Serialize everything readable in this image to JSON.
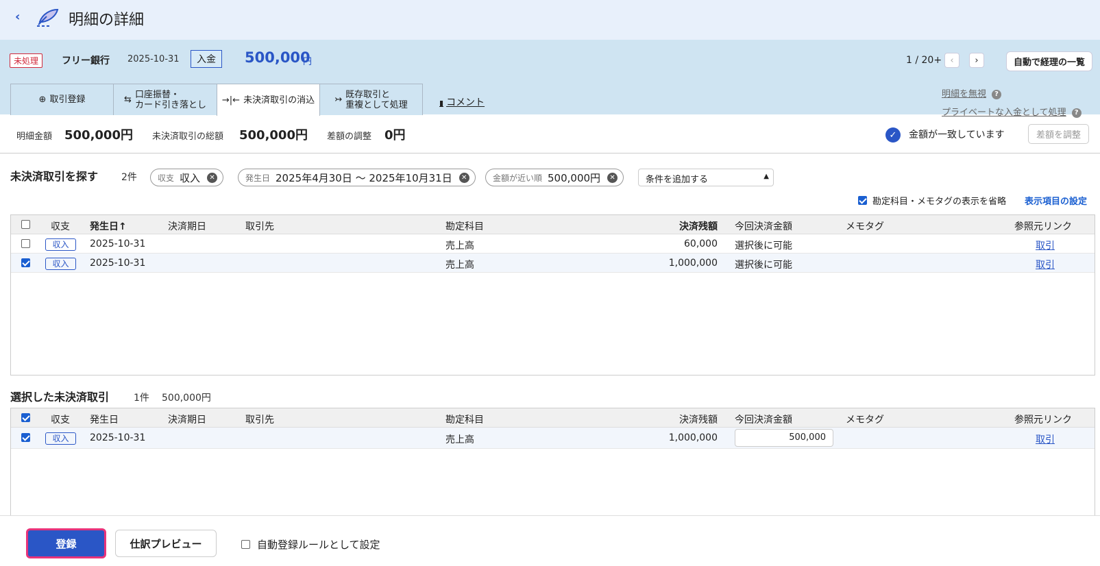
{
  "header": {
    "title": "明細の詳細",
    "back_icon": "chevron-left-icon",
    "logo_icon": "pen-feather-icon"
  },
  "transaction": {
    "status": "未処理",
    "bank": "フリー銀行",
    "date": "2025-10-31",
    "type": "入金",
    "amount": "500,000",
    "currency": "円",
    "pager": "1 / 20+",
    "auto_list": "自動で経理の一覧"
  },
  "tabs": [
    {
      "label1": "取引登録",
      "label2": "",
      "icon": "plus-circle-icon"
    },
    {
      "label1": "口座振替・",
      "label2": "カード引き落とし",
      "icon": "swap-arrows-icon"
    },
    {
      "label1": "未決済取引の消込",
      "label2": "",
      "icon": "merge-arrows-icon"
    },
    {
      "label1": "既存取引と",
      "label2": "重複として処理",
      "icon": "merge-right-icon"
    }
  ],
  "comment_label": "コメント",
  "right_links": {
    "ignore": "明細を無視",
    "private": "プライベートな入金として処理"
  },
  "summary": {
    "statement_label": "明細金額",
    "statement_value": "500,000円",
    "unsettled_label": "未決済取引の総額",
    "unsettled_value": "500,000円",
    "diff_label": "差額の調整",
    "diff_value": "0円",
    "match_text": "金額が一致しています",
    "adjust_button": "差額を調整"
  },
  "search": {
    "title": "未決済取引を探す",
    "count": "2件",
    "chips": [
      {
        "key": "収支",
        "value": "収入"
      },
      {
        "key": "発生日",
        "value": "2025年4月30日 〜 2025年10月31日"
      },
      {
        "key": "金額が近い順",
        "value": "500,000円"
      }
    ],
    "add_condition": "条件を追加する",
    "omit_label": "勘定科目・メモタグの表示を省略",
    "column_settings": "表示項目の設定"
  },
  "columns": {
    "type": "収支",
    "date": "発生日",
    "date_sort": "↑",
    "due": "決済期日",
    "partner": "取引先",
    "account": "勘定科目",
    "balance": "決済残額",
    "this_amount": "今回決済金額",
    "memo": "メモタグ",
    "ref": "参照元リンク"
  },
  "search_rows": [
    {
      "checked": false,
      "type": "収入",
      "date": "2025-10-31",
      "account": "売上高",
      "balance": "60,000",
      "this_amount": "選択後に可能",
      "ref": "取引"
    },
    {
      "checked": true,
      "type": "収入",
      "date": "2025-10-31",
      "account": "売上高",
      "balance": "1,000,000",
      "this_amount": "選択後に可能",
      "ref": "取引"
    }
  ],
  "selected": {
    "title": "選択した未決済取引",
    "count": "1件",
    "total": "500,000円",
    "rows": [
      {
        "checked": true,
        "type": "収入",
        "date": "2025-10-31",
        "account": "売上高",
        "balance": "1,000,000",
        "this_amount": "500,000",
        "ref": "取引"
      }
    ]
  },
  "footer": {
    "register": "登録",
    "preview": "仕訳プレビュー",
    "auto_rule": "自動登録ルールとして設定"
  }
}
